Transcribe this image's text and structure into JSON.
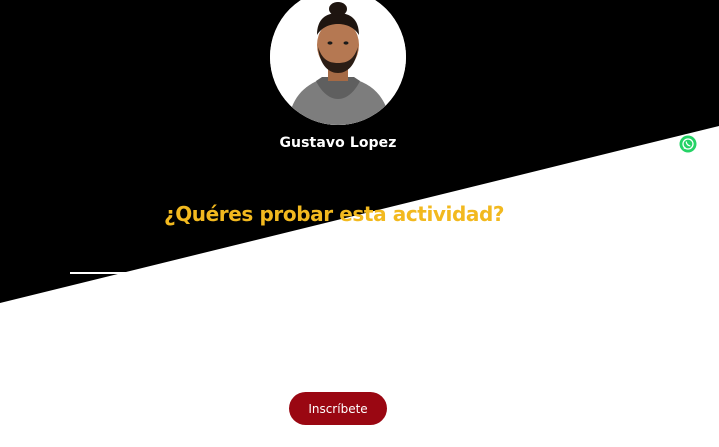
{
  "coach": {
    "name": "Gustavo Lopez",
    "avatar_icon": "coach-photo"
  },
  "cta": {
    "heading": "¿Quéres probar esta actividad?",
    "button_label": "Inscríbete"
  },
  "floating": {
    "whatsapp_icon": "whatsapp-icon"
  },
  "colors": {
    "dark_band": "#000000",
    "heading": "#f2b91f",
    "button": "#9a0712",
    "whatsapp": "#25d366"
  }
}
